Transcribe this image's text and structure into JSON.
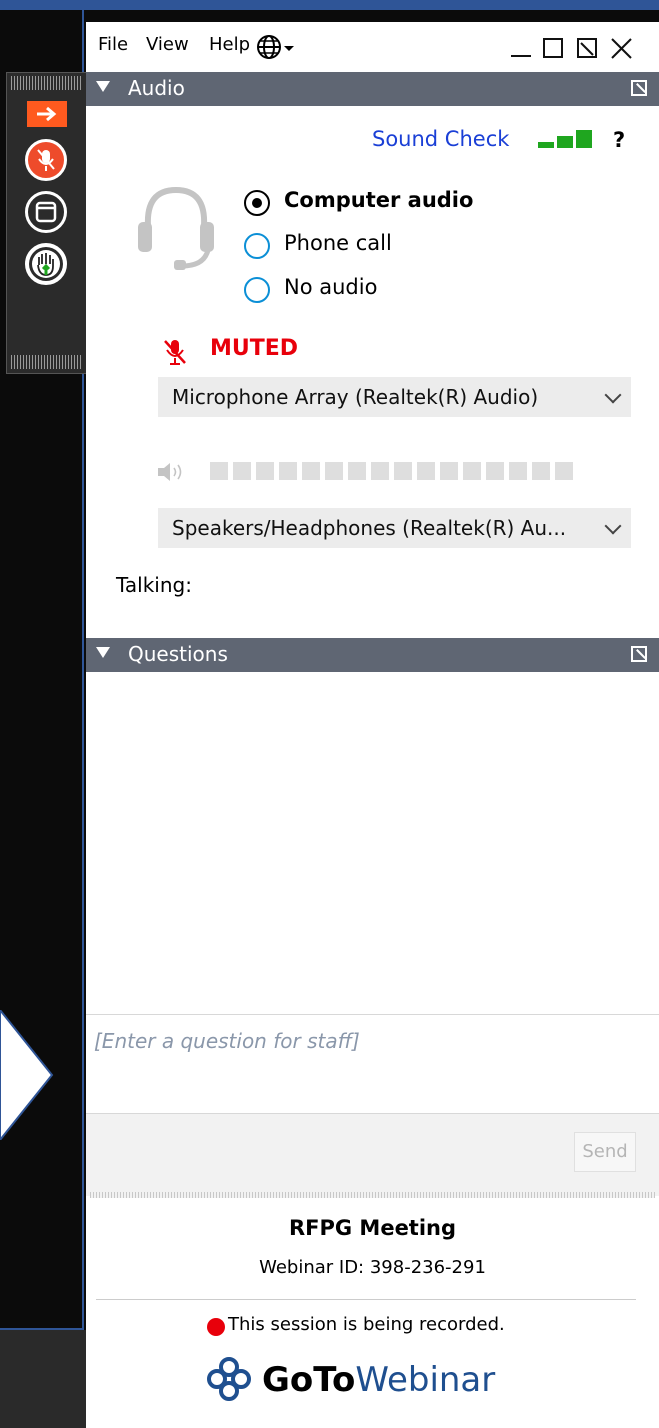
{
  "menu": {
    "file": "File",
    "view": "View",
    "help": "Help"
  },
  "audio_panel": {
    "title": "Audio",
    "sound_check": "Sound Check",
    "help": "?",
    "options": [
      {
        "label": "Computer audio",
        "selected": true
      },
      {
        "label": "Phone call",
        "selected": false
      },
      {
        "label": "No audio",
        "selected": false
      }
    ],
    "mute_status": "MUTED",
    "microphone": "Microphone Array (Realtek(R) Audio)",
    "speakers": "Speakers/Headphones  (Realtek(R)  Au...",
    "talking_label": "Talking:"
  },
  "questions_panel": {
    "title": "Questions",
    "placeholder": "[Enter a question for staff]",
    "send_label": "Send"
  },
  "footer": {
    "meeting_name": "RFPG Meeting",
    "webinar_id": "Webinar ID: 398-236-291",
    "recording_notice": "This session is being recorded.",
    "brand_bold": "GoTo",
    "brand_light": "Webinar"
  },
  "colors": {
    "accent_orange": "#ff5a1f",
    "mic_red": "#ee4b2b",
    "muted_red": "#e8000b",
    "sound_check_blue": "#1a3fd6",
    "panel_header": "#5f6673",
    "level_green": "#1fa61f",
    "hand_green": "#1fa61f"
  },
  "icons": {
    "sidebar": [
      "arrow-right-icon",
      "microphone-muted-icon",
      "window-icon",
      "raise-hand-icon"
    ],
    "audio": [
      "headset-icon",
      "signal-bars-icon",
      "microphone-off-icon",
      "speaker-icon"
    ],
    "menu": [
      "globe-icon"
    ],
    "brand": "gotowebinar-logo-icon"
  }
}
